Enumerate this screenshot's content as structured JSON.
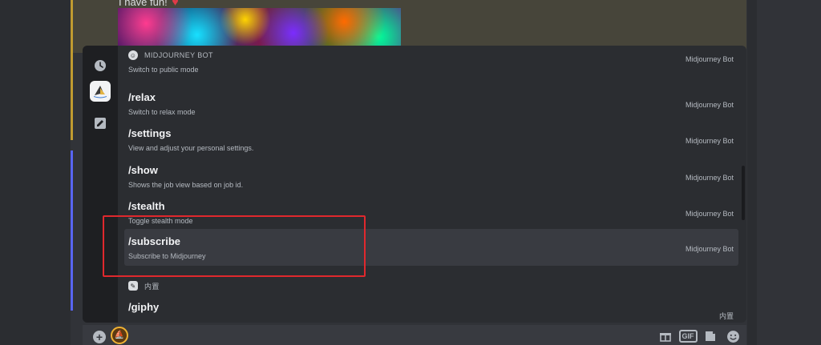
{
  "chat": {
    "message_text": "I have fun!",
    "heart": "♥"
  },
  "popup": {
    "rail": {
      "recent_icon": "clock-icon",
      "bot_icon": "midjourney-bot-icon",
      "builtin_icon": "builtin-icon"
    },
    "sections": {
      "bot": "MIDJOURNEY BOT",
      "builtin": "内置"
    },
    "commands": [
      {
        "name": "",
        "desc": "Switch to public mode",
        "source": "Midjourney Bot"
      },
      {
        "name": "/relax",
        "desc": "Switch to relax mode",
        "source": "Midjourney Bot"
      },
      {
        "name": "/settings",
        "desc": "View and adjust your personal settings.",
        "source": "Midjourney Bot"
      },
      {
        "name": "/show",
        "desc": "Shows the job view based on job id.",
        "source": "Midjourney Bot"
      },
      {
        "name": "/stealth",
        "desc": "Toggle stealth mode",
        "source": "Midjourney Bot"
      },
      {
        "name": "/subscribe",
        "desc": "Subscribe to Midjourney",
        "source": "Midjourney Bot"
      },
      {
        "name": "/giphy",
        "desc": "",
        "source": "内置"
      }
    ]
  },
  "composer": {
    "add_icon": "+",
    "avatar_icon": "midjourney-avatar-icon",
    "gift_icon": "gift-icon",
    "gif_label": "GIF",
    "sticker_icon": "sticker-icon",
    "emoji_icon": "emoji-icon"
  }
}
